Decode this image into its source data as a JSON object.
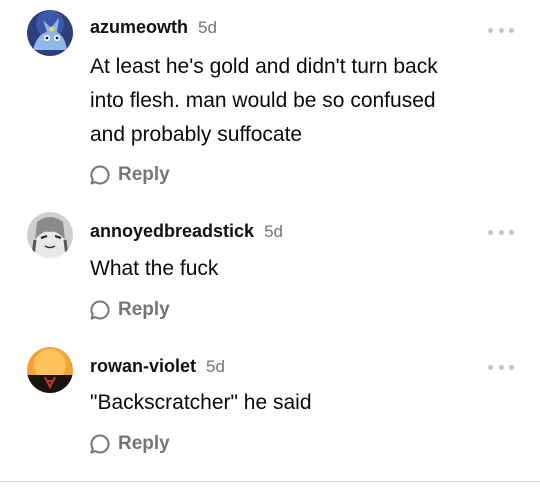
{
  "comments": [
    {
      "username": "azumeowth",
      "timestamp": "5d",
      "lines": [
        "At least he's gold and didn't turn back",
        "into flesh. man would be so confused",
        "and probably suffocate"
      ],
      "reply_label": "Reply",
      "avatar": "meowth-avatar"
    },
    {
      "username": "annoyedbreadstick",
      "timestamp": "5d",
      "lines": [
        "What the fuck"
      ],
      "reply_label": "Reply",
      "avatar": "character-avatar"
    },
    {
      "username": "rowan-violet",
      "timestamp": "5d",
      "lines": [
        "\"Backscratcher\" he said"
      ],
      "reply_label": "Reply",
      "avatar": "sunset-avatar"
    }
  ],
  "icons": {
    "more": "more-options-icon",
    "reply": "speech-bubble-icon"
  },
  "colors": {
    "text": "#0a0a0a",
    "muted": "#757575",
    "dots": "#c4c4c4"
  }
}
